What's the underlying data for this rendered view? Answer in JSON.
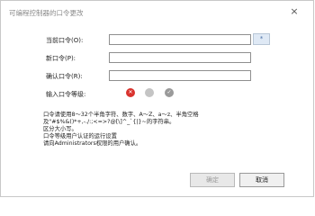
{
  "window": {
    "title": "可编程控制器的口令更改",
    "close_glyph": "×"
  },
  "form": {
    "current_password_label": "当前口令(O):",
    "new_password_label": "新口令(P):",
    "confirm_password_label": "确认口令(R):",
    "level_label": "输入口令等级:",
    "current_password_value": "",
    "new_password_value": "",
    "confirm_password_value": "",
    "reveal_button_glyph": "*"
  },
  "strength_level": {
    "active_index": 0,
    "levels": [
      {
        "icon": "error-icon",
        "color": "#d9332e",
        "glyph": "✕"
      },
      {
        "icon": "neutral-icon",
        "color": "#c4c4c4",
        "glyph": ""
      },
      {
        "icon": "check-icon",
        "color": "#9a9a9a",
        "glyph": "✓"
      }
    ]
  },
  "description": {
    "line1": "口令请使用8～32个半角字符、数字、A～Z、a～z、半角空格",
    "line2": "及\"#$%&()*+,-./:;<=>?@[\\]^_`{|}~的字符串。",
    "line3": "区分大小写。",
    "line4": "口令等级用户认证的运行设置",
    "line5": "请向Administrators权限的用户确认。"
  },
  "buttons": {
    "ok_label": "确定",
    "cancel_label": "取消"
  }
}
